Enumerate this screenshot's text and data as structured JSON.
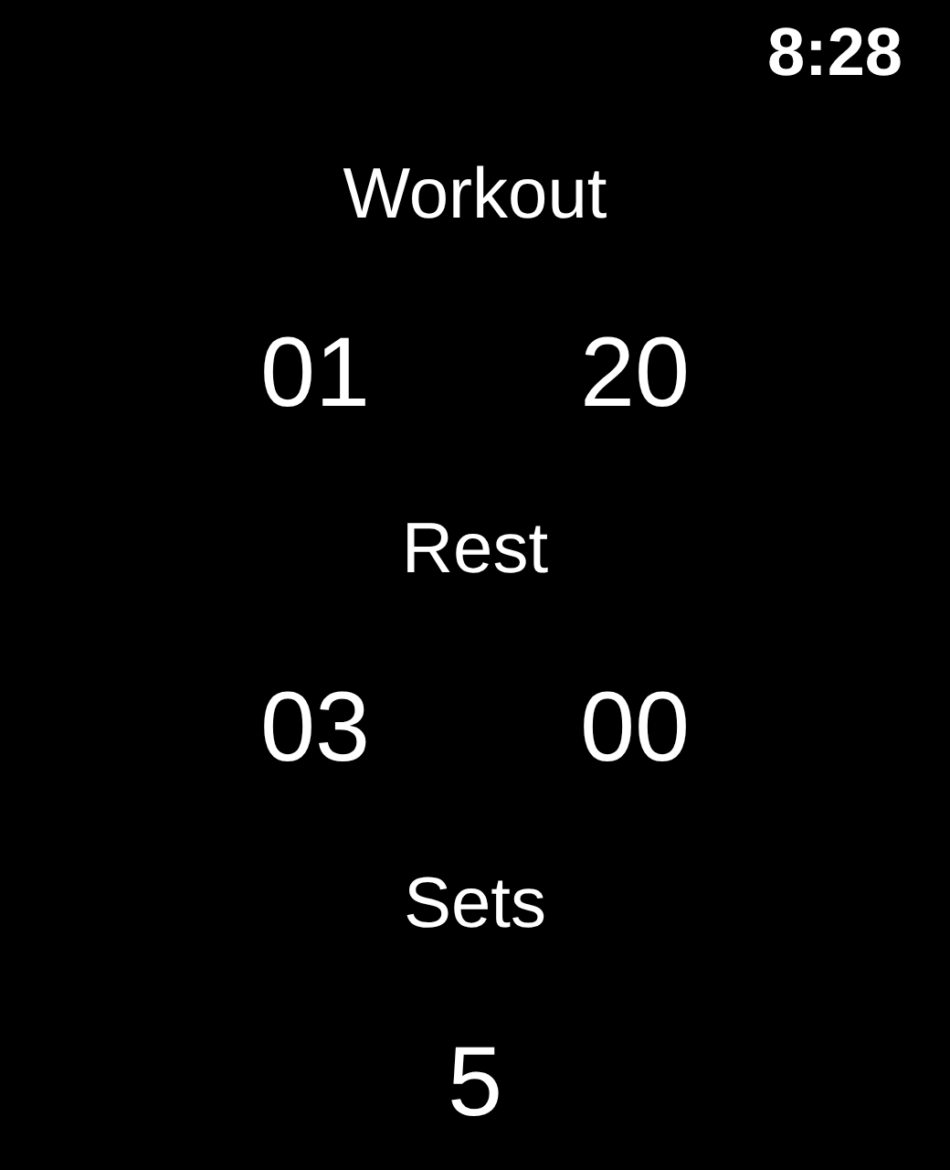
{
  "status_bar": {
    "time": "8:28"
  },
  "pickers": [
    {
      "label": "Workout",
      "values": [
        "01",
        "20"
      ]
    },
    {
      "label": "Rest",
      "values": [
        "03",
        "00"
      ]
    },
    {
      "label": "Sets",
      "values": [
        "5"
      ]
    }
  ]
}
